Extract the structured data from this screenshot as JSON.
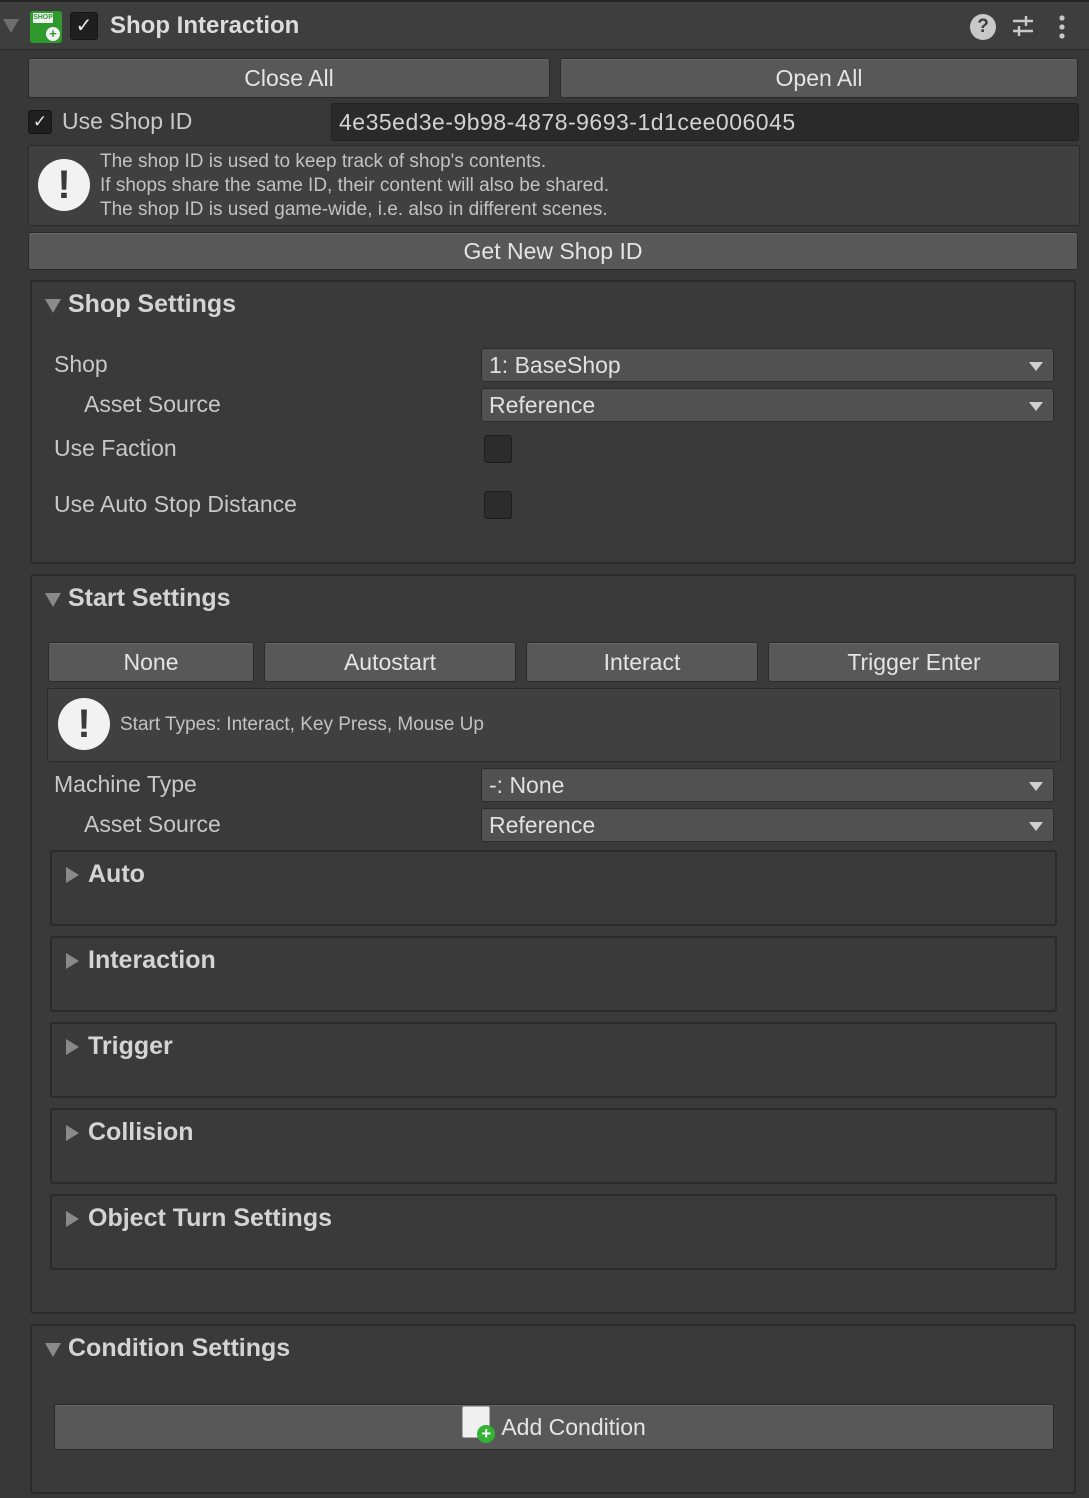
{
  "header": {
    "title": "Shop Interaction",
    "enabled_check": "✓",
    "icon_tag": "SHOP",
    "icons": [
      "help-icon",
      "preset-icon",
      "more-icon"
    ]
  },
  "toolbar": {
    "close_all": "Close All",
    "open_all": "Open All"
  },
  "shop_id": {
    "check": "✓",
    "label": "Use Shop ID",
    "value": "4e35ed3e-9b98-4878-9693-1d1cee006045",
    "help_lines": [
      "The shop ID is used to keep track of shop's contents.",
      "If shops share the same ID, their content will also be shared.",
      "The shop ID is used game-wide, i.e. also in different scenes."
    ],
    "new_id_button": "Get New Shop ID"
  },
  "shop_settings": {
    "title": "Shop Settings",
    "shop_label": "Shop",
    "shop_value": "1: BaseShop",
    "asset_source_label": "Asset Source",
    "asset_source_value": "Reference",
    "use_faction_label": "Use Faction",
    "use_faction": false,
    "use_auto_stop_label": "Use Auto Stop Distance",
    "use_auto_stop": false
  },
  "start_settings": {
    "title": "Start Settings",
    "start_buttons": [
      "None",
      "Autostart",
      "Interact",
      "Trigger Enter"
    ],
    "help": "Start Types: Interact, Key Press, Mouse Up",
    "machine_type_label": "Machine Type",
    "machine_type_value": "-: None",
    "asset_source_label": "Asset Source",
    "asset_source_value": "Reference",
    "foldouts": [
      "Auto",
      "Interaction",
      "Trigger",
      "Collision",
      "Object Turn Settings"
    ]
  },
  "condition_settings": {
    "title": "Condition Settings",
    "add_button": "Add Condition"
  }
}
